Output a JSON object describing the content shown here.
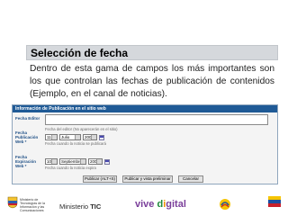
{
  "slide": {
    "title": "Selección de fecha",
    "body": "Dentro de esta gama de campos los más importantes son los que controlan las fechas de publicación de contenidos (Ejemplo, en el canal de noticias)."
  },
  "form": {
    "header": "Información de Publicación en el sitio web",
    "fecha_editor_label": "Fecha Editor",
    "editor_note": "Fecha del editor (No aparecerán en el sitio)",
    "publicacion_label": "Fecha Publicación Web *",
    "publicacion_day": "11",
    "publicacion_month": "Julio",
    "publicacion_year": "2005",
    "publicacion_hint": "Fecha cuando la noticia se publicará",
    "expiracion_label": "Fecha Expiración Web *",
    "expiracion_day": "10",
    "expiracion_month": "Septiembre",
    "expiracion_year": "2006",
    "expiracion_hint": "Fecha cuando la noticia expira",
    "btn_publicar": "Publicar (ALT+S)",
    "btn_preview": "Publicar y vista preliminar",
    "btn_cancel": "Cancelar"
  },
  "footer": {
    "mintic_text": "Ministerio de Tecnologías de la Información y las Comunicaciones",
    "ministerio": "Ministerio",
    "tic": "TIC",
    "vive": "vive ",
    "digital_d": "d",
    "digital_i": "i",
    "digital_rest": "gital"
  },
  "colors": {
    "title_bg": "#d5d8dc",
    "form_header": "#1f5a96",
    "arrow": "#2343a8",
    "vive_purple": "#7a3e9a"
  }
}
